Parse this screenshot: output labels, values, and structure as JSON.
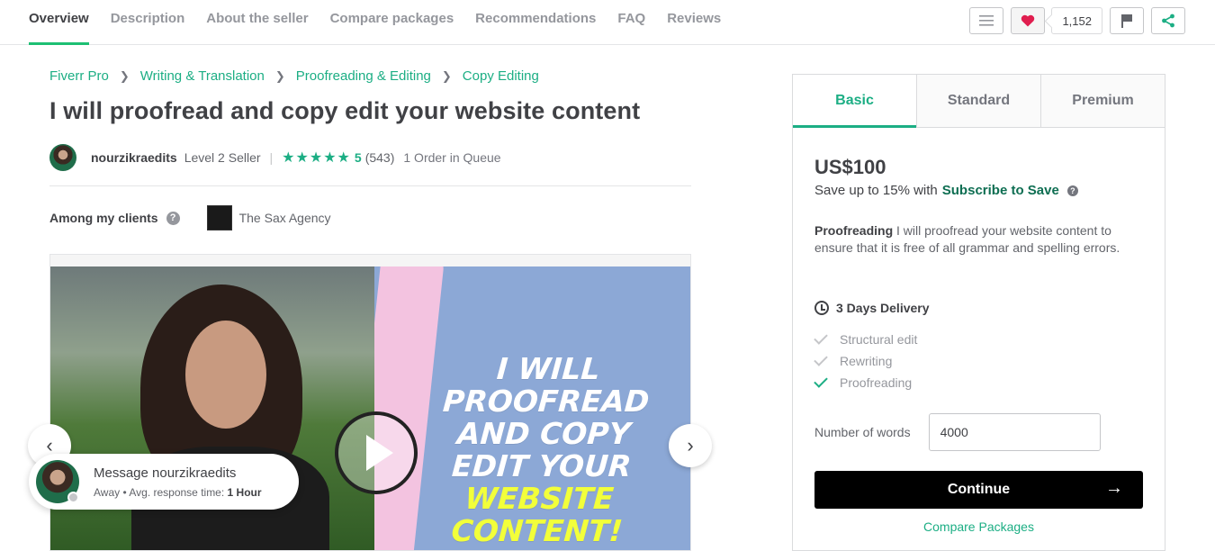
{
  "nav": {
    "tabs": [
      "Overview",
      "Description",
      "About the seller",
      "Compare packages",
      "Recommendations",
      "FAQ",
      "Reviews"
    ],
    "fav_count": "1,152"
  },
  "breadcrumb": [
    "Fiverr Pro",
    "Writing & Translation",
    "Proofreading & Editing",
    "Copy Editing"
  ],
  "gig": {
    "title": "I will proofread and copy edit your website content",
    "seller": "nourzikraedits",
    "level": "Level 2 Seller",
    "stars": "★★★★★",
    "rating": "5",
    "reviews": "(543)",
    "queue": "1 Order in Queue"
  },
  "clients": {
    "label": "Among my clients",
    "name": "The Sax Agency"
  },
  "media": {
    "line1": "I WILL",
    "line2": "PROOFREAD",
    "line3": "AND COPY",
    "line4": "EDIT YOUR",
    "line5": "WEBSITE",
    "line6": "CONTENT!"
  },
  "message": {
    "title": "Message nourzikraedits",
    "status": "Away",
    "resp_label": "Avg. response time:",
    "resp_value": "1 Hour"
  },
  "package": {
    "tabs": [
      "Basic",
      "Standard",
      "Premium"
    ],
    "price": "US$100",
    "save_text": "Save up to 15% with",
    "save_link": "Subscribe to Save",
    "desc_title": "Proofreading",
    "desc_body": " I will proofread your website content to ensure that it is free of all grammar and spelling errors.",
    "delivery": "3 Days Delivery",
    "features": [
      "Structural edit",
      "Rewriting",
      "Proofreading"
    ],
    "words_label": "Number of words",
    "words_value": "4000",
    "continue": "Continue",
    "compare": "Compare Packages"
  },
  "colors": {
    "accent": "#1cae84",
    "link_dark": "#0e6e52",
    "text": "#404145"
  }
}
